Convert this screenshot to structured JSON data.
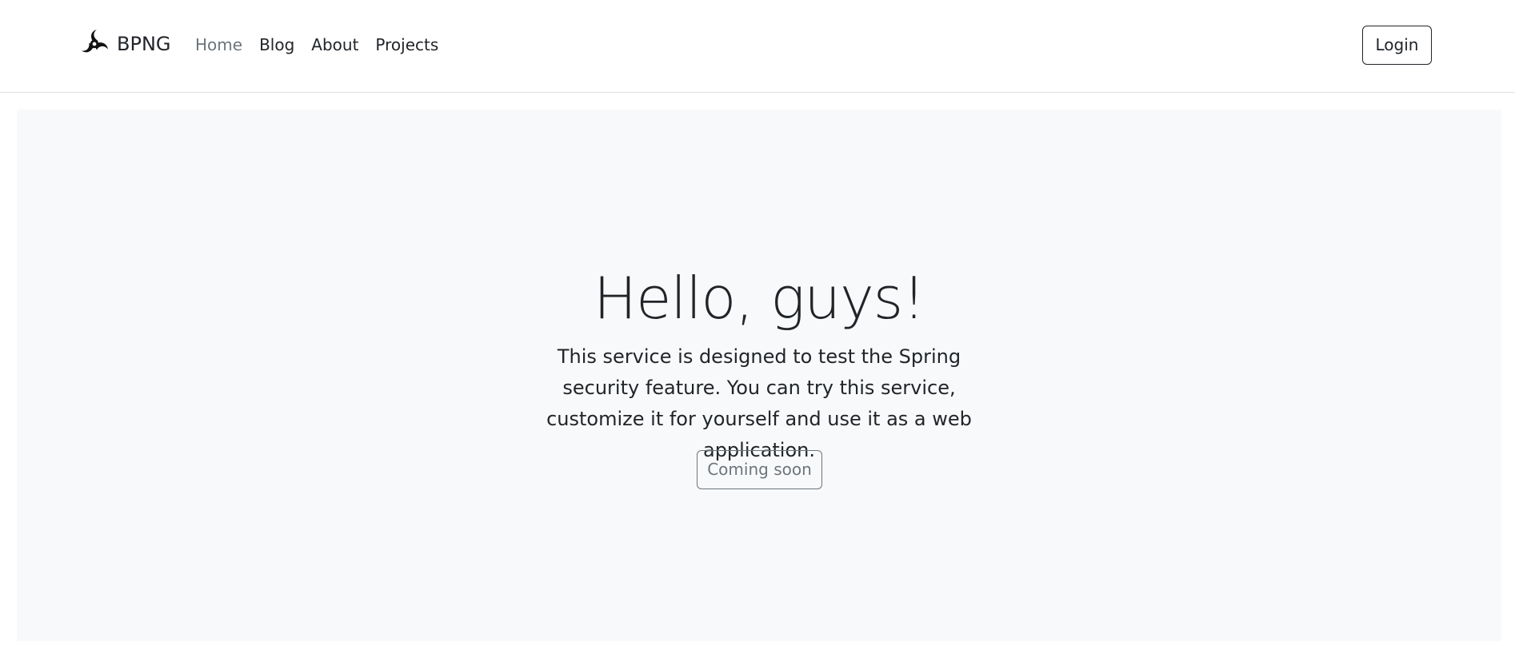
{
  "navbar": {
    "brand": {
      "icon": "swirl-logo-icon",
      "name": "BPNG"
    },
    "links": [
      {
        "label": "Home",
        "active": true
      },
      {
        "label": "Blog",
        "active": false
      },
      {
        "label": "About",
        "active": false
      },
      {
        "label": "Projects",
        "active": false
      }
    ],
    "login_label": "Login"
  },
  "hero": {
    "title": "Hello, guys!",
    "lead": "This service is designed to test the Spring security feature. You can try this service, customize it for yourself and use it as a web application.",
    "button_label": "Coming soon"
  },
  "colors": {
    "text": "#212529",
    "muted": "#6c757d",
    "hero_background": "#f8f9fa",
    "border": "#dee2e6"
  }
}
